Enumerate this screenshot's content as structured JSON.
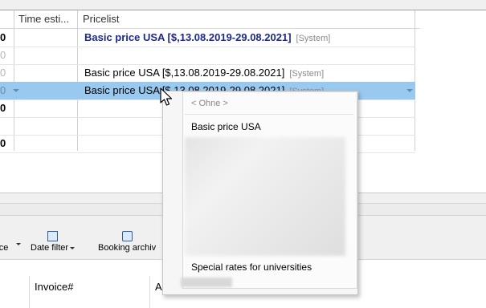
{
  "grid": {
    "columns": [
      "",
      "Time esti...",
      "Pricelist"
    ],
    "rows": [
      {
        "num": "0",
        "num_style": "bold",
        "pricelist": "Basic price USA [$,13.08.2019-29.08.2021]",
        "system": "[System]",
        "style": "bold"
      },
      {
        "num": "0",
        "num_style": "dim",
        "pricelist": "",
        "system": "",
        "style": ""
      },
      {
        "num": "0",
        "num_style": "dim",
        "pricelist": "Basic price USA [$,13.08.2019-29.08.2021]",
        "system": "[System]",
        "style": ""
      },
      {
        "num": "0",
        "num_style": "dim",
        "pricelist": "Basic price USA [$,13.08.2019-29.08.2021]",
        "system": "[System]",
        "style": "selected"
      },
      {
        "num": "0",
        "num_style": "bold",
        "pricelist": "",
        "system": "",
        "style": ""
      },
      {
        "num": "",
        "num_style": "",
        "pricelist": "",
        "system": "",
        "style": ""
      },
      {
        "num": "0",
        "num_style": "bold",
        "pricelist": "",
        "system": "",
        "style": ""
      }
    ]
  },
  "toolbar": {
    "items": [
      {
        "label": "ce",
        "icon": "filter-icon"
      },
      {
        "label": "Date filter",
        "icon": "calendar-icon"
      },
      {
        "label": "Booking archiv",
        "icon": "archive-icon"
      }
    ]
  },
  "bottom_table": {
    "columns": [
      "Invoice#",
      "A"
    ]
  },
  "dropdown": {
    "none_option": "< Ohne >",
    "options": [
      "Basic price USA",
      "Special rates for universities"
    ]
  },
  "colors": {
    "selection": "#99c9ef",
    "bold_text": "#1d2a8b"
  }
}
